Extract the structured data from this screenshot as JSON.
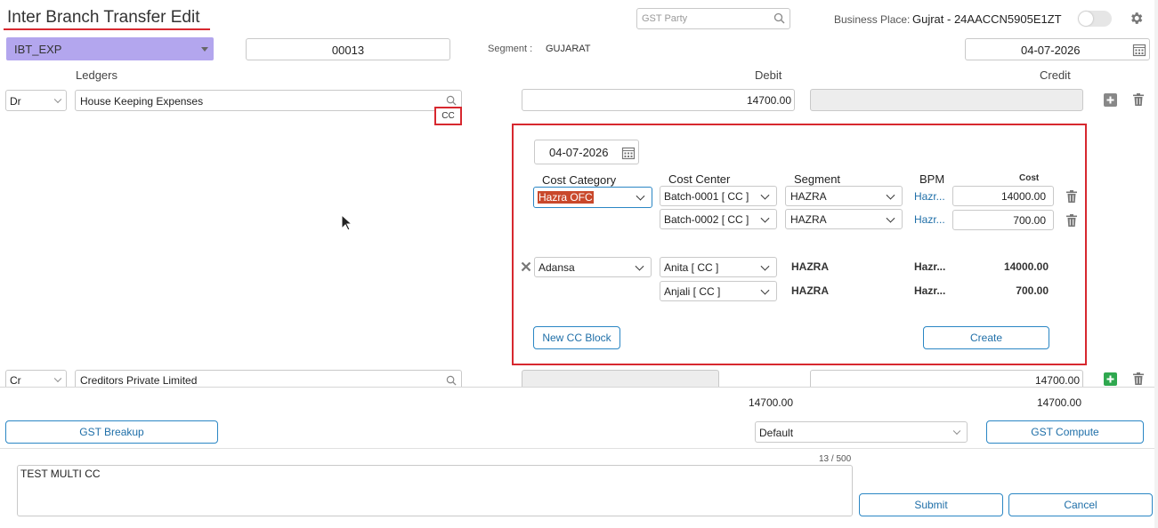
{
  "header": {
    "title": "Inter Branch Transfer Edit",
    "gst_party_placeholder": "GST Party",
    "business_place_label": "Business Place:",
    "business_place_value": "Gujrat - 24AACCN5905E1ZT"
  },
  "top": {
    "voucher_type": "IBT_EXP",
    "voucher_number": "00013",
    "segment_label": "Segment :",
    "segment_value": "GUJARAT",
    "date": "04-07-2026"
  },
  "columns": {
    "ledgers": "Ledgers",
    "debit": "Debit",
    "credit": "Credit"
  },
  "rows": [
    {
      "drcr": "Dr",
      "ledger": "House Keeping Expenses",
      "debit": "14700.00",
      "credit": ""
    },
    {
      "drcr": "Cr",
      "ledger": "Creditors Private Limited",
      "debit": "",
      "credit": "14700.00"
    }
  ],
  "cc_tag": "CC",
  "cost_panel": {
    "date": "04-07-2026",
    "headers": {
      "category": "Cost Category",
      "center": "Cost Center",
      "segment": "Segment",
      "bpm": "BPM",
      "cost": "Cost"
    },
    "edit_block": {
      "category": "Hazra OFC",
      "lines": [
        {
          "center": "Batch-0001 [ CC ]",
          "segment": "HAZRA",
          "bpm": "Hazr...",
          "cost": "14000.00"
        },
        {
          "center": "Batch-0002 [ CC ]",
          "segment": "HAZRA",
          "bpm": "Hazr...",
          "cost": "700.00"
        }
      ]
    },
    "saved_block": {
      "category": "Adansa",
      "lines": [
        {
          "center": "Anita [ CC ]",
          "segment": "HAZRA",
          "bpm": "Hazr...",
          "cost": "14000.00"
        },
        {
          "center": "Anjali [ CC ]",
          "segment": "HAZRA",
          "bpm": "Hazr...",
          "cost": "700.00"
        }
      ]
    },
    "new_block_label": "New CC Block",
    "create_label": "Create"
  },
  "totals": {
    "debit": "14700.00",
    "credit": "14700.00"
  },
  "footer": {
    "gst_breakup_label": "GST Breakup",
    "compute_option": "Default",
    "gst_compute_label": "GST Compute",
    "char_count": "13 / 500",
    "narration": "TEST MULTI CC",
    "submit_label": "Submit",
    "cancel_label": "Cancel"
  },
  "colors": {
    "accent_red": "#d7282f",
    "voucher_type_bg": "#b3a6ee",
    "link_blue": "#1f6fa8",
    "plus_green": "#2fa84f",
    "highlight": "#c9482b"
  }
}
